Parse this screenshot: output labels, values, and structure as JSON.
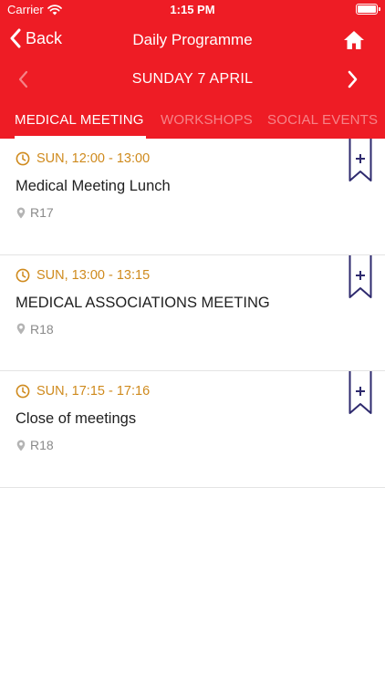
{
  "status_bar": {
    "carrier": "Carrier",
    "time": "1:15 PM"
  },
  "nav": {
    "back_label": "Back",
    "title": "Daily Programme"
  },
  "date_bar": {
    "label": "SUNDAY 7 APRIL"
  },
  "tabs": [
    {
      "label": "MEDICAL MEETING",
      "active": true
    },
    {
      "label": "WORKSHOPS",
      "active": false
    },
    {
      "label": "SOCIAL EVENTS",
      "active": false
    }
  ],
  "items": [
    {
      "time": "SUN, 12:00 - 13:00",
      "title": "Medical Meeting Lunch",
      "location": "R17"
    },
    {
      "time": "SUN, 13:00 - 13:15",
      "title": "MEDICAL ASSOCIATIONS MEETING",
      "location": "R18"
    },
    {
      "time": "SUN, 17:15 - 17:16",
      "title": "Close of meetings",
      "location": "R18"
    }
  ],
  "colors": {
    "header": "#ee1c25",
    "time": "#cf8a1d",
    "bookmark": "#2e2a6e",
    "location": "#8a8a8a"
  },
  "icons": [
    "wifi-icon",
    "battery-icon",
    "back-chevron-icon",
    "home-icon",
    "chevron-left-icon",
    "chevron-right-icon",
    "clock-icon",
    "location-pin-icon",
    "bookmark-add-icon"
  ]
}
